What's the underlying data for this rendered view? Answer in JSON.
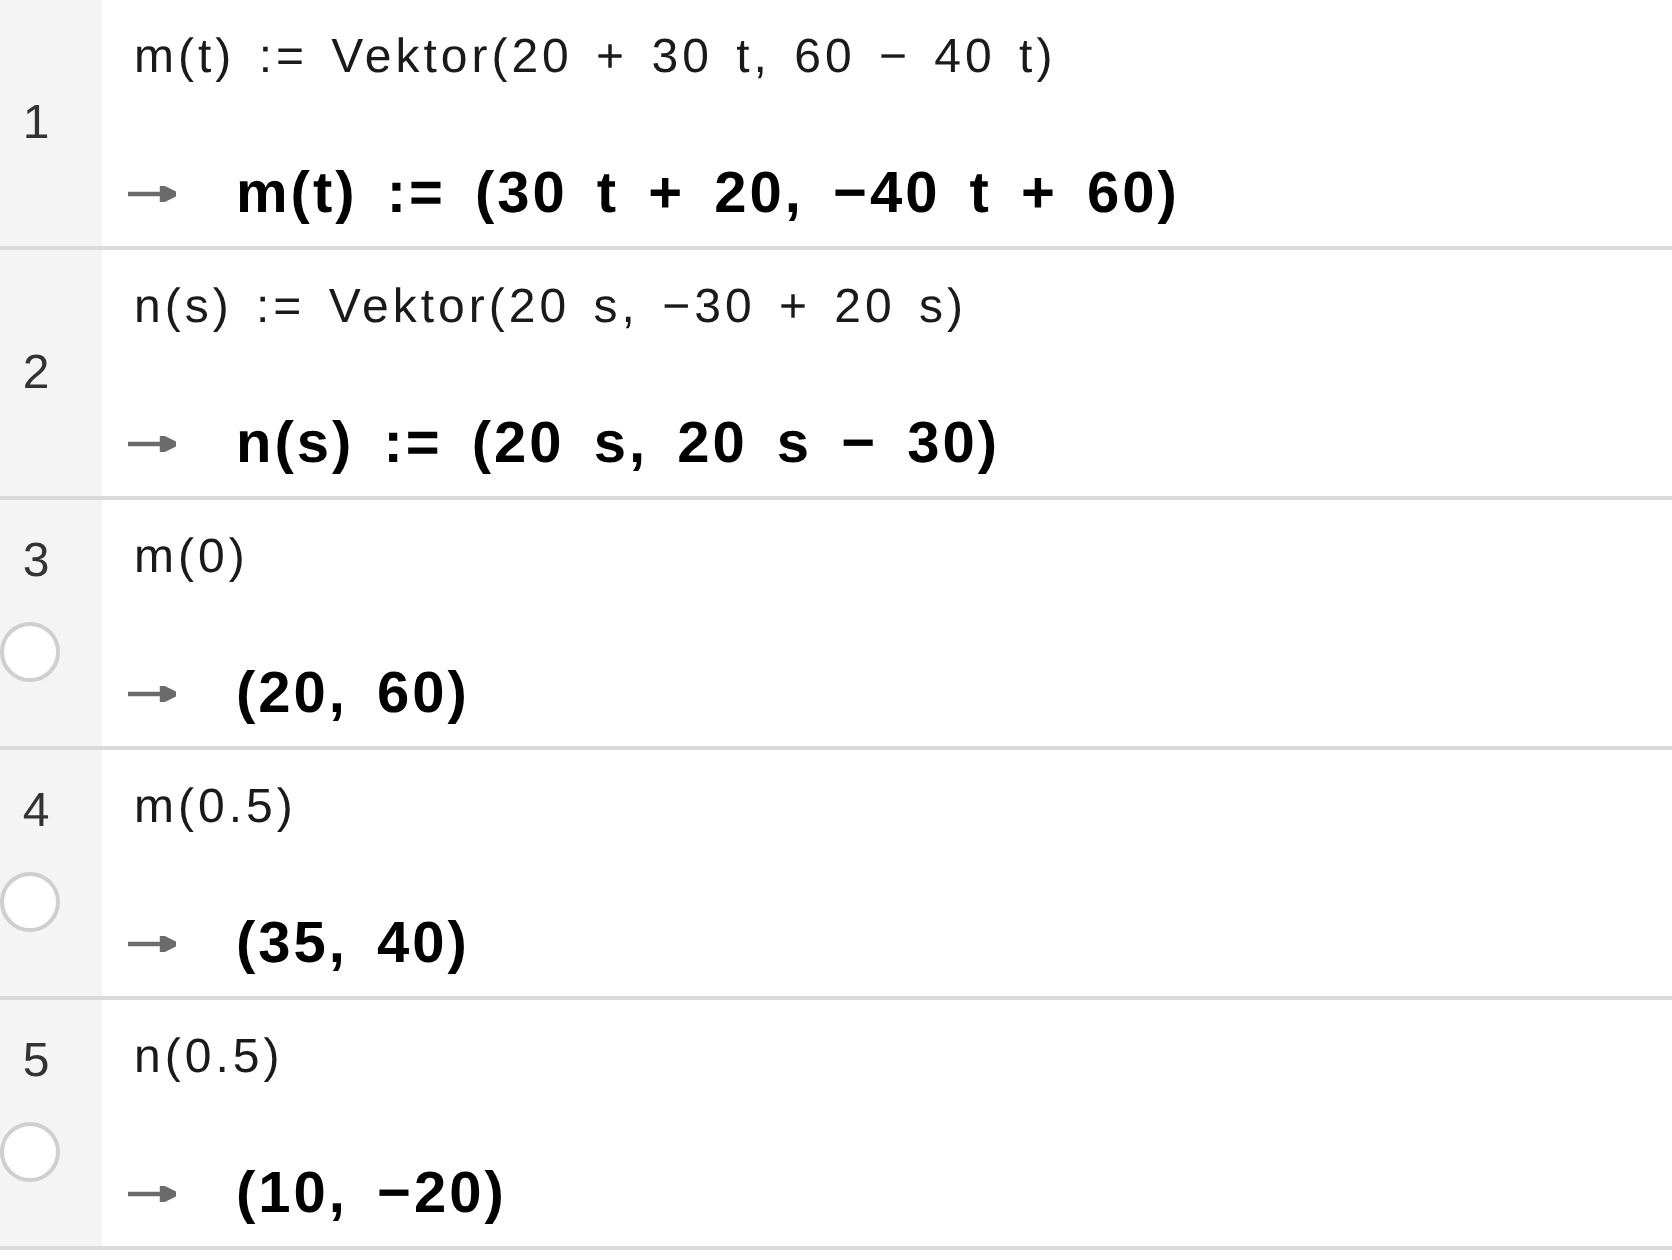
{
  "cas_rows": [
    {
      "number": "1",
      "input": "m(t) := Vektor(20 + 30 t, 60 − 40 t)",
      "output": "m(t) := (30 t + 20, −40 t + 60)"
    },
    {
      "number": "2",
      "input": "n(s) := Vektor(20 s, −30 + 20 s)",
      "output": "n(s) := (20 s, 20 s − 30)"
    },
    {
      "number": "3",
      "input": "m(0)",
      "output": "(20, 60)",
      "graph_toggle": {
        "on": false
      }
    },
    {
      "number": "4",
      "input": "m(0.5)",
      "output": "(35, 40)",
      "graph_toggle": {
        "on": false
      }
    },
    {
      "number": "5",
      "input": "n(0.5)",
      "output": "(10, −20)",
      "graph_toggle": {
        "on": false
      }
    }
  ]
}
